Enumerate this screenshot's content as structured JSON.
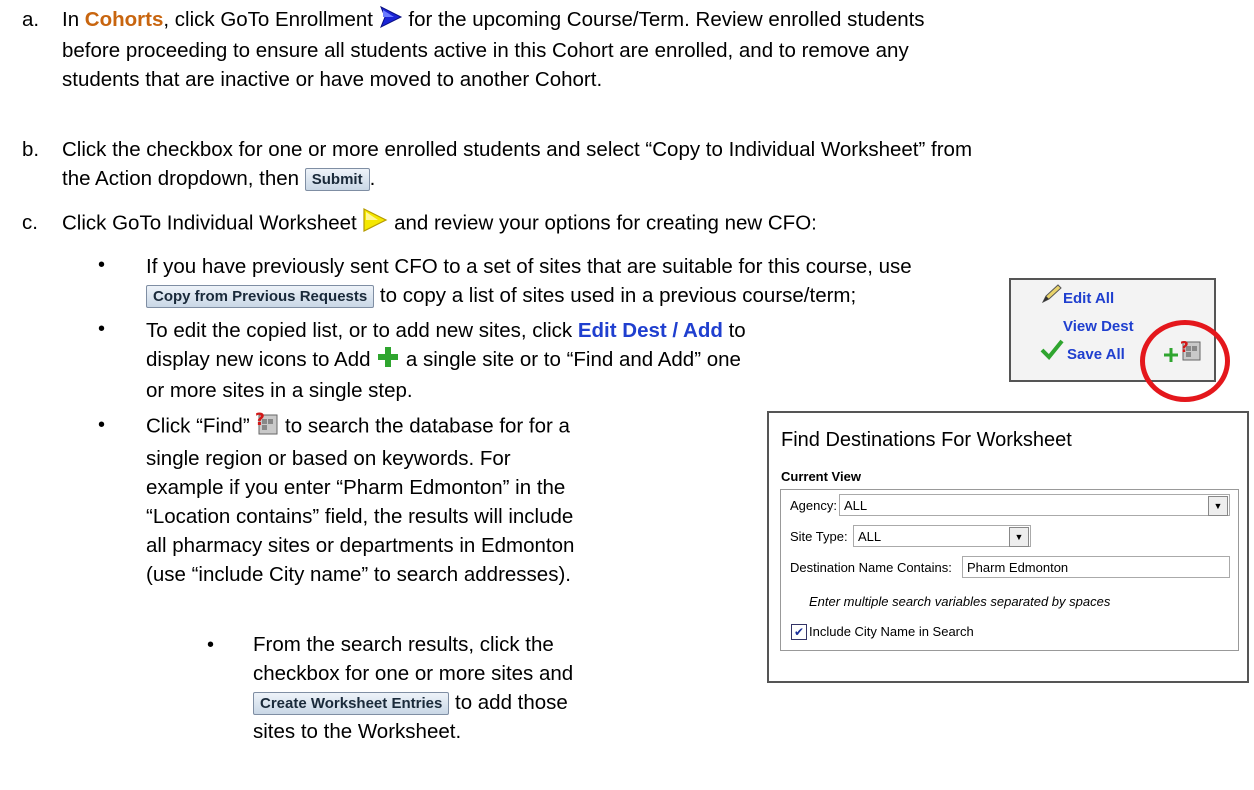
{
  "step_a": {
    "letter": "a.",
    "text_before": "In ",
    "cohorts": "Cohorts",
    "text_after": ", click GoTo Enrollment",
    "line1_rest": " for the upcoming Course/Term.  Review enrolled students",
    "line2": "before proceeding to ensure all students active in this Cohort are enrolled, and to remove any",
    "line3": "students that are inactive or have moved to another Cohort."
  },
  "step_b": {
    "letter": "b.",
    "line1": "Click the checkbox for one or more enrolled students and select “Copy to Individual Worksheet” from",
    "line2_before": "the Action dropdown, then",
    "submit_label": "Submit",
    "line2_after": "."
  },
  "step_c": {
    "letter": "c.",
    "text_before": "Click GoTo Individual Worksheet",
    "text_after": " and review your options for creating new CFO:"
  },
  "bullet1": {
    "line1": "If you have previously sent CFO to a set of sites that are suitable for this course, use",
    "button_label": "Copy from Previous Requests",
    "line2_after": " to copy a list of sites used in a previous course/term;"
  },
  "bullet2": {
    "line1_before": "To edit the copied list, or to add new sites, click ",
    "link_label": "Edit Dest / Add",
    "line1_after": " to",
    "line2_before": "display new icons to Add",
    "line2_after": " a single site or to “Find and Add”  one",
    "line3": "or more sites in a single step."
  },
  "edit_panel": {
    "edit_all": "Edit All",
    "view_dest": "View Dest",
    "save_all": "Save All"
  },
  "bullet3": {
    "line1_before": "Click “Find”",
    "line1_after": " to search the database for for a",
    "line2": "single region or based on keywords.  For",
    "line3": "example if you enter “Pharm Edmonton” in the",
    "line4": "“Location contains” field, the results will include",
    "line5": "all pharmacy sites or departments in Edmonton",
    "line6": "(use “include City name” to search addresses)."
  },
  "sub_bullet": {
    "line1": "From the search results, click the",
    "line2": "checkbox for one or more sites and",
    "button_label": "Create Worksheet Entries",
    "line3_after": " to add those",
    "line4": "sites to the Worksheet."
  },
  "find_dialog": {
    "title": "Find Destinations For Worksheet",
    "section": "Current View",
    "agency_label": "Agency:",
    "agency_value": "ALL",
    "site_type_label": "Site Type:",
    "site_type_value": "ALL",
    "dest_label": "Destination Name Contains:",
    "dest_value": "Pharm Edmonton",
    "hint": "Enter multiple search variables separated by spaces",
    "include_city_label": "Include City Name in Search",
    "include_city_checked": true
  },
  "colors": {
    "cohorts": "#c8650f",
    "link_blue": "#1f3fcf",
    "circle_red": "#e4171c",
    "plus_green": "#2fa52f"
  }
}
